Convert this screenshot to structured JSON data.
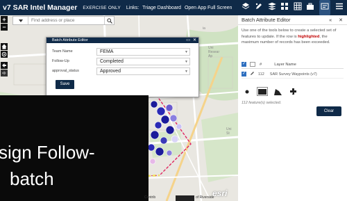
{
  "header": {
    "title": "v7 SAR Intel Manager",
    "badge": "EXERCISE ONLY",
    "links_label": "Links:",
    "links": [
      "Triage Dashboard",
      "Open App Full Screen"
    ]
  },
  "widgets": [
    "layers-icon",
    "edit-icon",
    "stack-icon",
    "grid-icon",
    "table-icon",
    "briefcase-icon",
    "batch-edit-icon",
    "menu-icon"
  ],
  "map": {
    "zoom_in": "+",
    "zoom_out": "−",
    "search": {
      "placeholder": "Find address or place"
    },
    "labels": [
      "Uni\nResear\nAp",
      "ia",
      "Uni\nSt",
      "Contrib",
      "of Riverside"
    ],
    "attribution": "esri"
  },
  "dialog": {
    "title": "Batch Attribute Editor",
    "fields": [
      {
        "label": "Team Name",
        "value": "FEMA"
      },
      {
        "label": "Follow-Up",
        "value": "Completed"
      },
      {
        "label": "approval_status",
        "value": "Approved"
      }
    ],
    "save_label": "Save"
  },
  "caption": {
    "line1": "sign Follow-",
    "line2": "batch"
  },
  "panel": {
    "title": "Batch Attribute Editor",
    "instructions_pre": "Use one of the tools below to create a selected set of features to update. If the row is ",
    "instructions_bold": "highlighted",
    "instructions_post": ", the maximum number of records has been exceeded.",
    "table_header": {
      "hash": "#",
      "layer": "Layer Name"
    },
    "rows": [
      {
        "count": "112",
        "layer": "SAR Survey Waypoints (v7)"
      }
    ],
    "selected_count": "112 feature(s) selected.",
    "clear_label": "Clear"
  }
}
